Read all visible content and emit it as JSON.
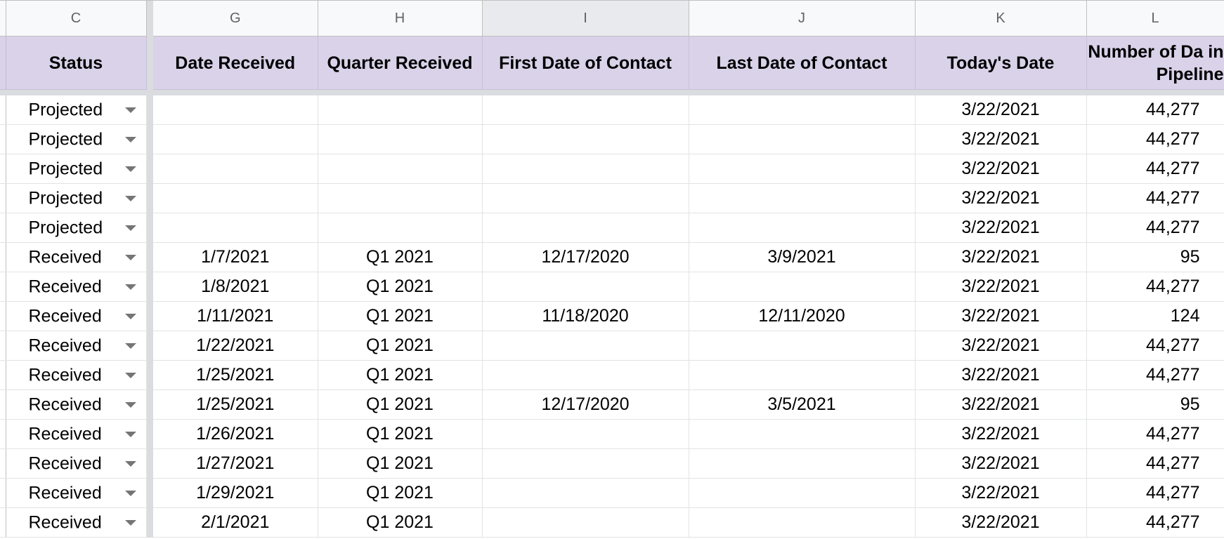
{
  "columns": {
    "letters": [
      "C",
      "G",
      "H",
      "I",
      "J",
      "K",
      "L"
    ],
    "headers": [
      "Status",
      "Date Received",
      "Quarter Received",
      "First Date of Contact",
      "Last Date of Contact",
      "Today's Date",
      "Number of Da in Pipeline"
    ]
  },
  "rows": [
    {
      "status": "Projected",
      "date_received": "",
      "quarter": "",
      "first_contact": "",
      "last_contact": "",
      "today": "3/22/2021",
      "days": "44,277"
    },
    {
      "status": "Projected",
      "date_received": "",
      "quarter": "",
      "first_contact": "",
      "last_contact": "",
      "today": "3/22/2021",
      "days": "44,277"
    },
    {
      "status": "Projected",
      "date_received": "",
      "quarter": "",
      "first_contact": "",
      "last_contact": "",
      "today": "3/22/2021",
      "days": "44,277"
    },
    {
      "status": "Projected",
      "date_received": "",
      "quarter": "",
      "first_contact": "",
      "last_contact": "",
      "today": "3/22/2021",
      "days": "44,277"
    },
    {
      "status": "Projected",
      "date_received": "",
      "quarter": "",
      "first_contact": "",
      "last_contact": "",
      "today": "3/22/2021",
      "days": "44,277"
    },
    {
      "status": "Received",
      "date_received": "1/7/2021",
      "quarter": "Q1 2021",
      "first_contact": "12/17/2020",
      "last_contact": "3/9/2021",
      "today": "3/22/2021",
      "days": "95"
    },
    {
      "status": "Received",
      "date_received": "1/8/2021",
      "quarter": "Q1 2021",
      "first_contact": "",
      "last_contact": "",
      "today": "3/22/2021",
      "days": "44,277"
    },
    {
      "status": "Received",
      "date_received": "1/11/2021",
      "quarter": "Q1 2021",
      "first_contact": "11/18/2020",
      "last_contact": "12/11/2020",
      "today": "3/22/2021",
      "days": "124"
    },
    {
      "status": "Received",
      "date_received": "1/22/2021",
      "quarter": "Q1 2021",
      "first_contact": "",
      "last_contact": "",
      "today": "3/22/2021",
      "days": "44,277"
    },
    {
      "status": "Received",
      "date_received": "1/25/2021",
      "quarter": "Q1 2021",
      "first_contact": "",
      "last_contact": "",
      "today": "3/22/2021",
      "days": "44,277"
    },
    {
      "status": "Received",
      "date_received": "1/25/2021",
      "quarter": "Q1 2021",
      "first_contact": "12/17/2020",
      "last_contact": "3/5/2021",
      "today": "3/22/2021",
      "days": "95"
    },
    {
      "status": "Received",
      "date_received": "1/26/2021",
      "quarter": "Q1 2021",
      "first_contact": "",
      "last_contact": "",
      "today": "3/22/2021",
      "days": "44,277"
    },
    {
      "status": "Received",
      "date_received": "1/27/2021",
      "quarter": "Q1 2021",
      "first_contact": "",
      "last_contact": "",
      "today": "3/22/2021",
      "days": "44,277"
    },
    {
      "status": "Received",
      "date_received": "1/29/2021",
      "quarter": "Q1 2021",
      "first_contact": "",
      "last_contact": "",
      "today": "3/22/2021",
      "days": "44,277"
    },
    {
      "status": "Received",
      "date_received": "2/1/2021",
      "quarter": "Q1 2021",
      "first_contact": "",
      "last_contact": "",
      "today": "3/22/2021",
      "days": "44,277"
    }
  ],
  "colors": {
    "header_bg": "#d9d2e9",
    "freeze_bar": "#dadce0",
    "grid_line": "#e2e3e3"
  }
}
